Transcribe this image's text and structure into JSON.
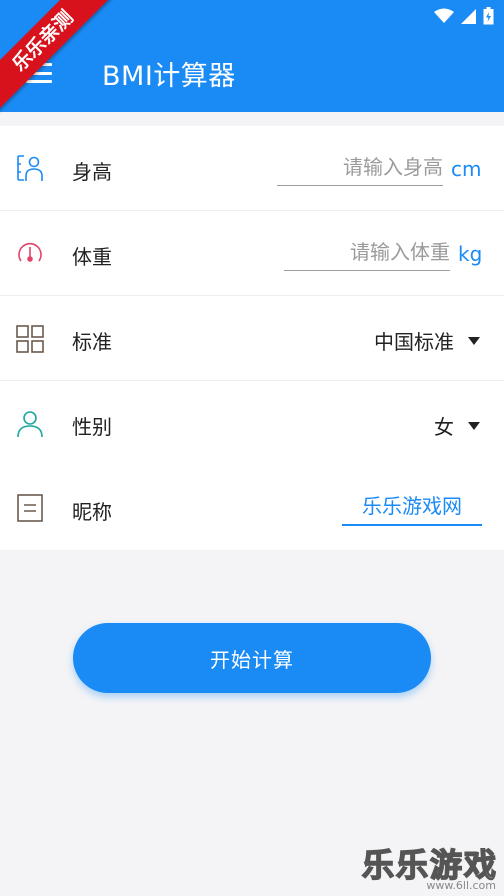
{
  "app": {
    "title": "BMI计算器"
  },
  "ribbon": {
    "text": "乐乐亲测"
  },
  "status_icons": [
    "wifi-icon",
    "signal-icon",
    "battery-icon"
  ],
  "menu_icon": "menu-icon",
  "form": {
    "height": {
      "label": "身高",
      "placeholder": "请输入身高",
      "value": "",
      "unit": "cm",
      "icon": "person-measure-icon"
    },
    "weight": {
      "label": "体重",
      "placeholder": "请输入体重",
      "value": "",
      "unit": "kg",
      "icon": "gauge-icon"
    },
    "standard": {
      "label": "标准",
      "selected": "中国标准",
      "icon": "grid-icon"
    },
    "gender": {
      "label": "性别",
      "selected": "女",
      "icon": "user-icon"
    },
    "nickname": {
      "label": "昵称",
      "value": "乐乐游戏网",
      "icon": "document-icon"
    }
  },
  "actions": {
    "calculate": "开始计算"
  },
  "watermark": {
    "title": "乐乐游戏",
    "url": "www.6ll.com"
  },
  "colors": {
    "primary": "#1a8bf5",
    "ribbon": "#d8121c",
    "accent_pink": "#e0446a",
    "accent_teal": "#1aa79e",
    "icon_brown": "#6b5a4e"
  }
}
